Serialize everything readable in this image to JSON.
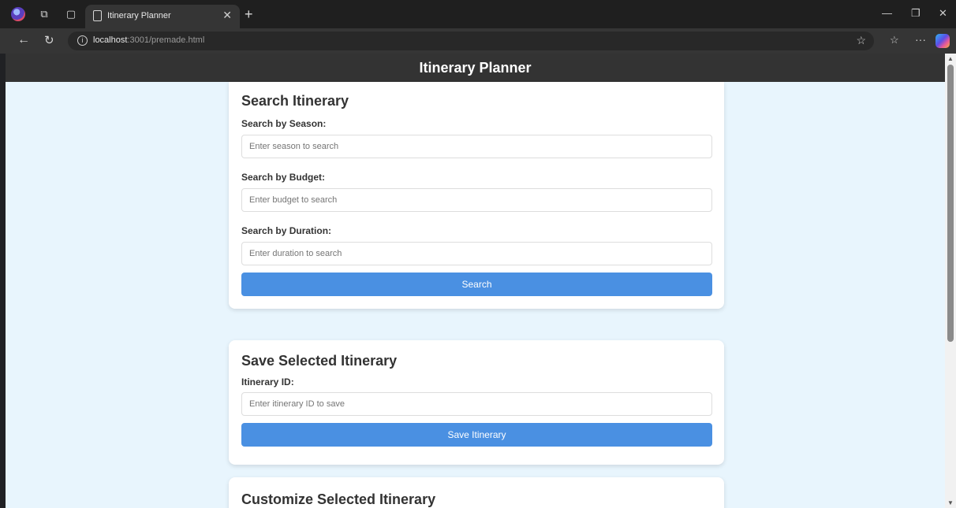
{
  "browser": {
    "tab_title": "Itinerary Planner",
    "url_host": "localhost",
    "url_path": ":3001/premade.html"
  },
  "app": {
    "header_title": "Itinerary Planner"
  },
  "search_section": {
    "title": "Search Itinerary",
    "season_label": "Search by Season:",
    "season_placeholder": "Enter season to search",
    "budget_label": "Search by Budget:",
    "budget_placeholder": "Enter budget to search",
    "duration_label": "Search by Duration:",
    "duration_placeholder": "Enter duration to search",
    "search_button": "Search"
  },
  "save_section": {
    "title": "Save Selected Itinerary",
    "id_label": "Itinerary ID:",
    "id_placeholder": "Enter itinerary ID to save",
    "save_button": "Save Itinerary"
  },
  "customize_section": {
    "title": "Customize Selected Itinerary"
  },
  "colors": {
    "page_background": "#e8f5fd",
    "header_background": "#333333",
    "button_primary": "#4a90e2"
  }
}
